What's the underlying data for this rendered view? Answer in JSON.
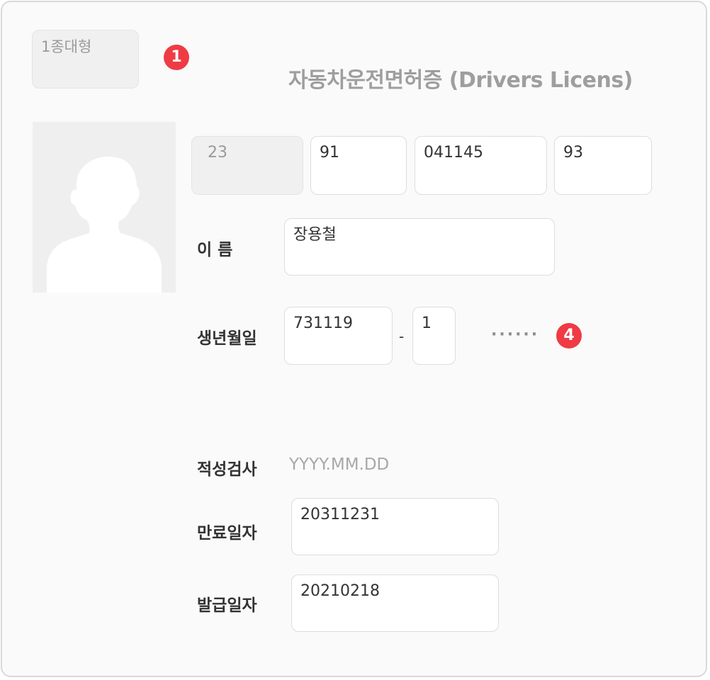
{
  "license": {
    "type": "1종대형",
    "title": "자동차운전면허증 (Drivers Licens)",
    "badges": {
      "first": "1",
      "second": "4"
    },
    "number": {
      "region": "23",
      "year": "91",
      "serial": "041145",
      "check": "93"
    },
    "name_label": "이 름",
    "name_value": "장용철",
    "birth_label": "생년월일",
    "birth_date": "731119",
    "birth_separator": "-",
    "gender_digit": "1",
    "masked": "······",
    "aptitude_label": "적성검사",
    "aptitude_value": "YYYY.MM.DD",
    "expiry_label": "만료일자",
    "expiry_value": "20311231",
    "issue_label": "발급일자",
    "issue_value": "20210218"
  },
  "colors": {
    "badge": "#ef3b44",
    "border": "#dddddd",
    "card": "#fafafa"
  },
  "photo": {
    "icon": "person-silhouette-icon"
  }
}
